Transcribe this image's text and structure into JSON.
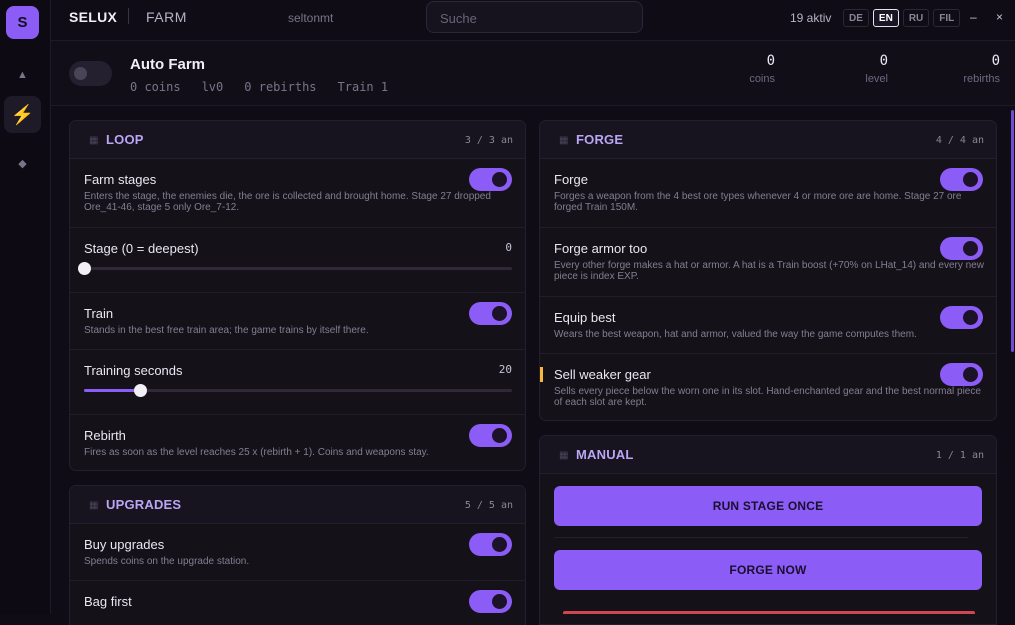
{
  "rail": {
    "logo": "S",
    "items": [
      "▲",
      "⚡",
      "◆"
    ]
  },
  "topbar": {
    "brand": "SELUX",
    "section": "FARM",
    "user": "seltonmt",
    "search_placeholder": "Suche",
    "active_count": "19 aktiv",
    "languages": [
      "DE",
      "EN",
      "RU",
      "FIL"
    ],
    "selected_language": "EN",
    "minimize": "–",
    "close": "×"
  },
  "header": {
    "title": "Auto Farm",
    "meta": [
      "0 coins",
      "lv0",
      "0 rebirths",
      "Train 1"
    ],
    "stats": [
      {
        "value": "0",
        "label": "coins"
      },
      {
        "value": "0",
        "label": "level"
      },
      {
        "value": "0",
        "label": "rebirths"
      }
    ]
  },
  "loop": {
    "title": "LOOP",
    "count": "3 / 3 an",
    "farm_stages": {
      "name": "Farm stages",
      "desc": "Enters the stage, the enemies die, the ore is collected and brought home. Stage 27 dropped Ore_41-46, stage 5 only Ore_7-12.",
      "on": true
    },
    "stage": {
      "name": "Stage (0 = deepest)",
      "value": "0",
      "fraction": 0
    },
    "train": {
      "name": "Train",
      "desc": "Stands in the best free train area; the game trains by itself there.",
      "on": true
    },
    "training_seconds": {
      "name": "Training seconds",
      "value": "20",
      "fraction": 0.13
    },
    "rebirth": {
      "name": "Rebirth",
      "desc": "Fires as soon as the level reaches 25 x (rebirth + 1). Coins and weapons stay.",
      "on": true
    }
  },
  "upgrades": {
    "title": "UPGRADES",
    "count": "5 / 5 an",
    "buy_upgrades": {
      "name": "Buy upgrades",
      "desc": "Spends coins on the upgrade station.",
      "on": true
    },
    "bag_first": {
      "name": "Bag first",
      "on": true
    }
  },
  "forge": {
    "title": "FORGE",
    "count": "4 / 4 an",
    "forge": {
      "name": "Forge",
      "desc": "Forges a weapon from the 4 best ore types whenever 4 or more ore are home. Stage 27 ore forged Train 150M.",
      "on": true
    },
    "forge_armor": {
      "name": "Forge armor too",
      "desc": "Every other forge makes a hat or armor. A hat is a Train boost (+70% on LHat_14) and every new piece is index EXP.",
      "on": true
    },
    "equip_best": {
      "name": "Equip best",
      "desc": "Wears the best weapon, hat and armor, valued the way the game computes them.",
      "on": true
    },
    "sell_weaker": {
      "name": "Sell weaker gear",
      "desc": "Sells every piece below the worn one in its slot. Hand-enchanted gear and the best normal piece of each slot are kept.",
      "on": true
    }
  },
  "manual": {
    "title": "MANUAL",
    "count": "1 / 1 an",
    "run_stage": "RUN STAGE ONCE",
    "forge_now": "FORGE NOW"
  },
  "colors": {
    "accent": "#8b5cf6",
    "background": "#0f0c15",
    "card": "#141119",
    "warning": "#f5b83d",
    "danger": "#d04552"
  }
}
